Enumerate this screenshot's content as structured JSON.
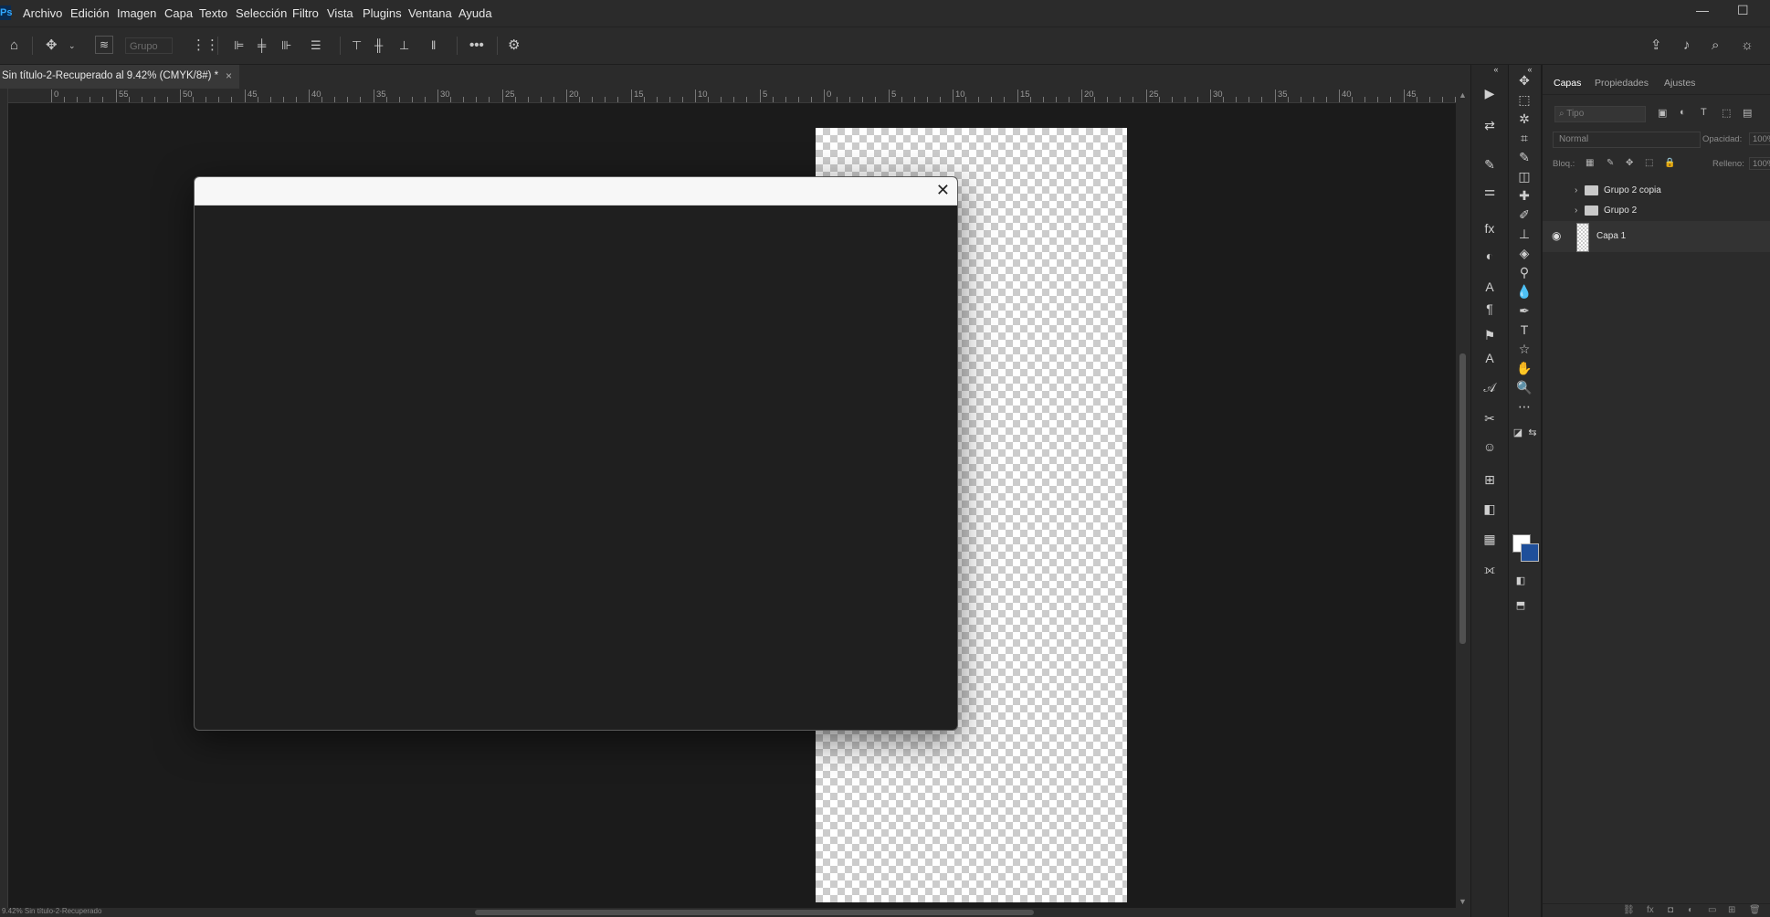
{
  "app": {
    "logo": "Ps"
  },
  "menu": [
    "Archivo",
    "Edición",
    "Imagen",
    "Capa",
    "Texto",
    "Selección",
    "Filtro",
    "Vista",
    "Plugins",
    "Ventana",
    "Ayuda"
  ],
  "window_controls": {
    "minimize": "—",
    "maximize": "☐"
  },
  "options_bar": {
    "auto_select_value": "Grupo",
    "icons": [
      "home-icon",
      "move-tool-icon",
      "chevron-down-icon",
      "layer-select-icon",
      "transform-grid-icon",
      "align-left-icon",
      "align-center-icon",
      "align-right-icon",
      "distribute-icon",
      "align-top-icon",
      "align-middle-icon",
      "align-bottom-icon",
      "distribute-vertical-icon",
      "more-icon",
      "settings-icon",
      "share-icon",
      "bell-icon",
      "search-icon",
      "lightbulb-icon"
    ]
  },
  "document": {
    "tab_title": "Sin título-2-Recuperado al 9.42% (CMYK/8#) *",
    "tab_close": "×"
  },
  "ruler": {
    "labels": [
      "0",
      "55",
      "50",
      "45",
      "40",
      "35",
      "30",
      "25",
      "20",
      "15",
      "10",
      "5",
      "0",
      "5",
      "10",
      "15",
      "20",
      "25",
      "30",
      "35",
      "40",
      "45"
    ]
  },
  "dialog": {
    "close_glyph": "✕"
  },
  "status": {
    "text": "9.42%   Sin título-2-Recuperado"
  },
  "scrollbar": {
    "up": "▲",
    "down": "▼"
  },
  "panel_collapse": [
    "«",
    "«"
  ],
  "tools": [
    "move-tool-icon",
    "marquee-tool-icon",
    "magic-wand-icon",
    "crop-tool-icon",
    "eyedropper-icon",
    "eraser-icon",
    "healing-brush-icon",
    "brush-tool-icon",
    "stamp-tool-icon",
    "paint-bucket-icon",
    "dodge-tool-icon",
    "blur-tool-icon",
    "pen-tool-icon",
    "type-tool-icon",
    "shape-tool-icon",
    "hand-tool-icon",
    "zoom-tool-icon",
    "more-tools-icon"
  ],
  "tool_glyphs": [
    "✥",
    "⬚",
    "✲",
    "⌗",
    "✎",
    "◫",
    "✚",
    "✐",
    "⊥",
    "◈",
    "⚲",
    "💧",
    "✒",
    "T",
    "☆",
    "✋",
    "🔍",
    "⋯"
  ],
  "panel_strip_glyphs": [
    "▶",
    "⇄",
    "✎",
    "⚌",
    "fx",
    "◐",
    "A",
    "¶",
    "⚑",
    "A",
    "𝒜",
    "✂",
    "☺",
    "⊞",
    "◧",
    "▦",
    "⟗"
  ],
  "layers_panel": {
    "tabs": [
      "Capas",
      "Propiedades",
      "Ajustes"
    ],
    "filter_placeholder": "Tipo",
    "blend_mode": "Normal",
    "opacity_label": "Opacidad:",
    "opacity_value": "100%",
    "lock_label": "Bloq.:",
    "fill_label": "Relleno:",
    "fill_value": "100%",
    "layers": [
      {
        "name": "Grupo 2 copia",
        "type": "group",
        "visible": false
      },
      {
        "name": "Grupo 2",
        "type": "group",
        "visible": false
      },
      {
        "name": "Capa 1",
        "type": "layer",
        "visible": true,
        "selected": true
      }
    ]
  },
  "colors": {
    "menubar_bg": "#2b2b2b",
    "canvas_bg": "#1b1b1b",
    "dialog_titlebar": "#f7f7f7",
    "dialog_body": "#1f1f1f",
    "foreground_color": "#ffffff",
    "background_color": "#1f4f9a"
  }
}
